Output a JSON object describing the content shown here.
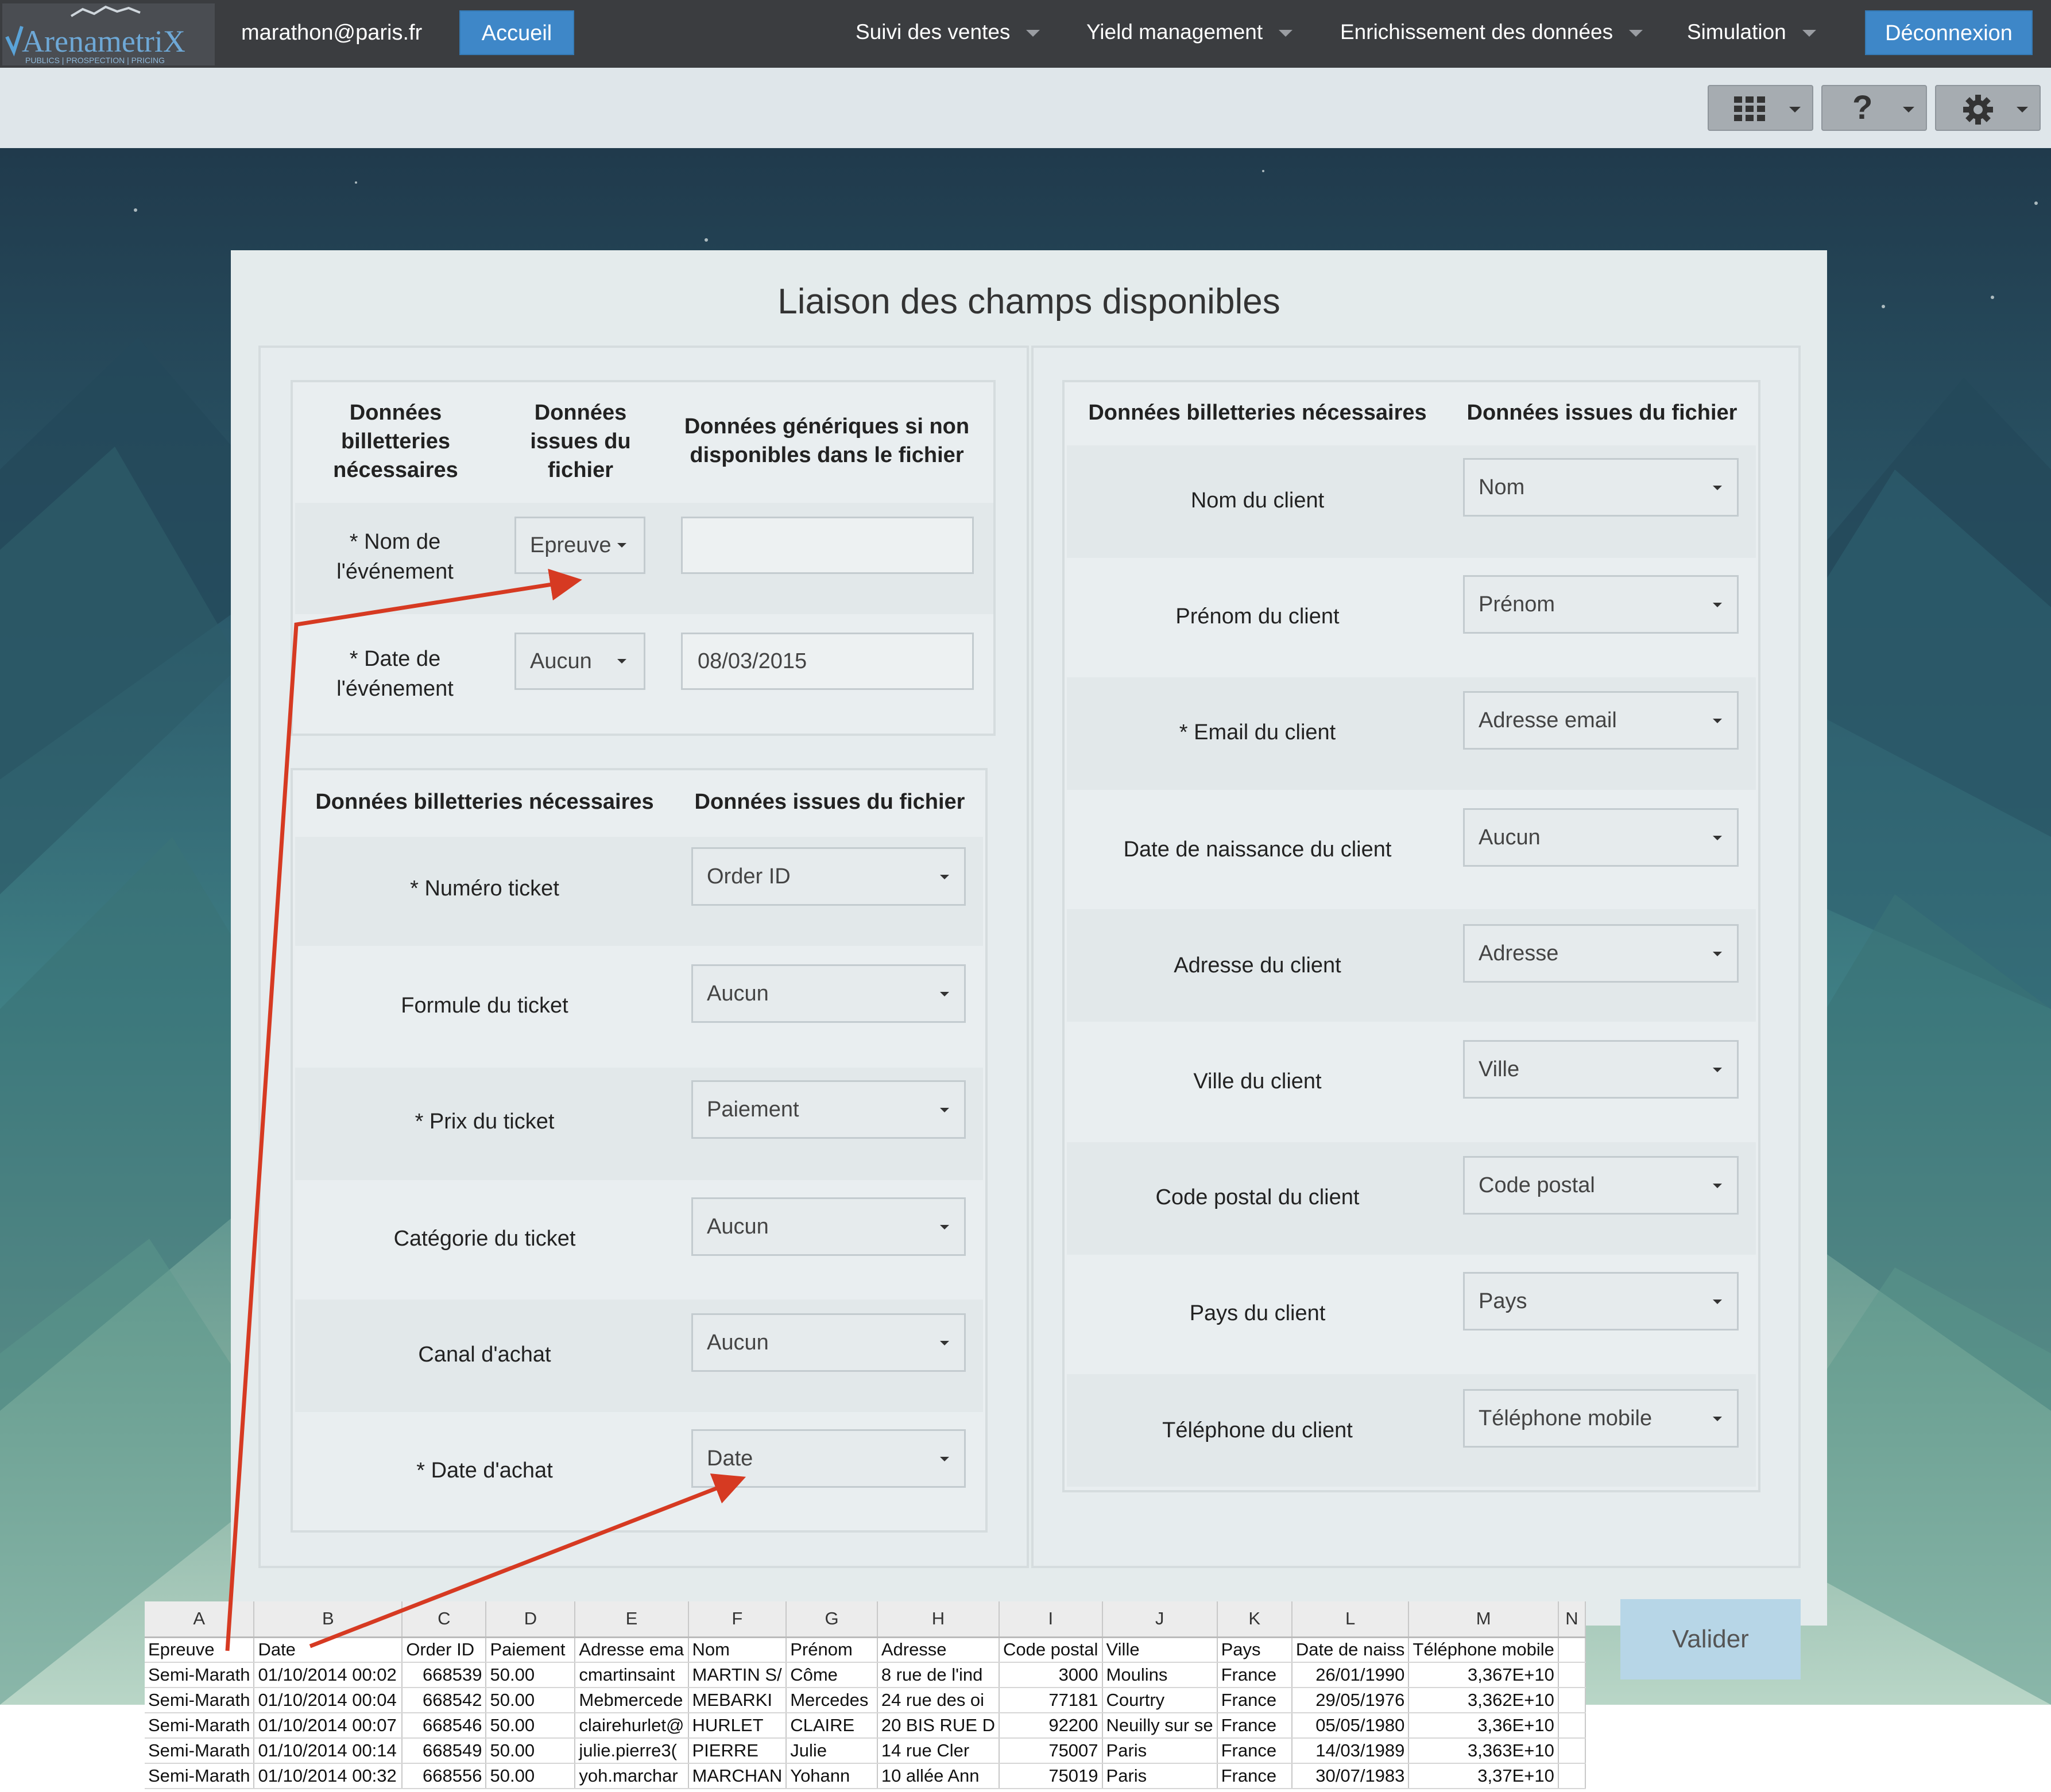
{
  "header": {
    "logo_text": "ArenametriX",
    "logo_tagline": "PUBLICS | PROSPECTION | PRICING",
    "user_email": "marathon@paris.fr",
    "home_label": "Accueil",
    "nav": [
      "Suivi des ventes",
      "Yield management",
      "Enrichissement des données",
      "Simulation"
    ],
    "logout_label": "Déconnexion"
  },
  "toolbar": {
    "apps_icon": "grid-icon",
    "help_icon": "question-icon",
    "settings_icon": "gear-icon"
  },
  "page_title": "Liaison des champs disponibles",
  "event_section": {
    "headers": [
      "Données billetteries nécessaires",
      "Données issues du fichier",
      "Données génériques si non disponibles dans le fichier"
    ],
    "rows": [
      {
        "label": "* Nom de l'événement",
        "file_value": "Epreuve",
        "generic_value": ""
      },
      {
        "label": "* Date de l'événement",
        "file_value": "Aucun",
        "generic_value": "08/03/2015"
      }
    ]
  },
  "ticket_section": {
    "headers": [
      "Données billetteries nécessaires",
      "Données issues du fichier"
    ],
    "rows": [
      {
        "label": "* Numéro ticket",
        "value": "Order ID"
      },
      {
        "label": "Formule du ticket",
        "value": "Aucun"
      },
      {
        "label": "* Prix du ticket",
        "value": "Paiement"
      },
      {
        "label": "Catégorie du ticket",
        "value": "Aucun"
      },
      {
        "label": "Canal d'achat",
        "value": "Aucun"
      },
      {
        "label": "* Date d'achat",
        "value": "Date"
      }
    ]
  },
  "client_section": {
    "headers": [
      "Données billetteries nécessaires",
      "Données issues du fichier"
    ],
    "rows": [
      {
        "label": "Nom du client",
        "value": "Nom"
      },
      {
        "label": "Prénom du client",
        "value": "Prénom"
      },
      {
        "label": "* Email du client",
        "value": "Adresse email"
      },
      {
        "label": "Date de naissance du client",
        "value": "Aucun"
      },
      {
        "label": "Adresse du client",
        "value": "Adresse"
      },
      {
        "label": "Ville du client",
        "value": "Ville"
      },
      {
        "label": "Code postal du client",
        "value": "Code postal"
      },
      {
        "label": "Pays du client",
        "value": "Pays"
      },
      {
        "label": "Téléphone du client",
        "value": "Téléphone mobile"
      }
    ]
  },
  "validate_label": "Valider",
  "spreadsheet": {
    "col_letters": [
      "A",
      "B",
      "C",
      "D",
      "E",
      "F",
      "G",
      "H",
      "I",
      "J",
      "K",
      "L",
      "M",
      "N"
    ],
    "headers": [
      "Epreuve",
      "Date",
      "Order ID",
      "Paiement",
      "Adresse ema",
      "Nom",
      "Prénom",
      "Adresse",
      "Code postal",
      "Ville",
      "Pays",
      "Date de naiss",
      "Téléphone mobile",
      ""
    ],
    "rows": [
      [
        "Semi-Marath",
        "01/10/2014 00:02",
        "668539",
        "50.00",
        "cmartinsaint",
        "MARTIN S/",
        "Côme",
        "8 rue de l'ind",
        "3000",
        "Moulins",
        "France",
        "26/01/1990",
        "3,367E+10",
        ""
      ],
      [
        "Semi-Marath",
        "01/10/2014 00:04",
        "668542",
        "50.00",
        "Mebmercede",
        "MEBARKI",
        "Mercedes",
        "24 rue des oi",
        "77181",
        "Courtry",
        "France",
        "29/05/1976",
        "3,362E+10",
        ""
      ],
      [
        "Semi-Marath",
        "01/10/2014 00:07",
        "668546",
        "50.00",
        "clairehurlet@",
        "HURLET",
        "CLAIRE",
        "20 BIS RUE D",
        "92200",
        "Neuilly sur se",
        "France",
        "05/05/1980",
        "3,36E+10",
        ""
      ],
      [
        "Semi-Marath",
        "01/10/2014 00:14",
        "668549",
        "50.00",
        "julie.pierre3(",
        "PIERRE",
        "Julie",
        "14 rue Cler",
        "75007",
        "Paris",
        "France",
        "14/03/1989",
        "3,363E+10",
        ""
      ],
      [
        "Semi-Marath",
        "01/10/2014 00:32",
        "668556",
        "50.00",
        "yoh.marchar",
        "MARCHAN",
        "Yohann",
        "10 allée Ann",
        "75019",
        "Paris",
        "France",
        "30/07/1983",
        "3,37E+10",
        ""
      ]
    ]
  }
}
